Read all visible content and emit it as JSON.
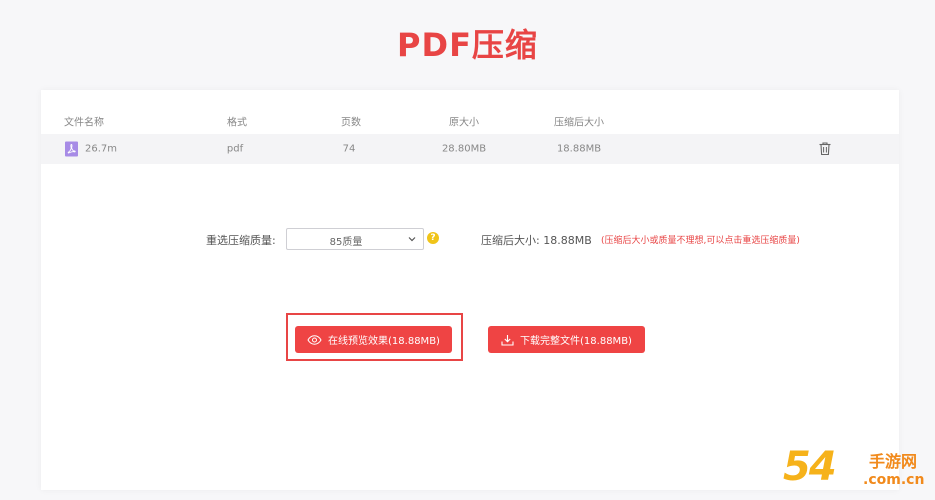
{
  "page": {
    "title": "PDF压缩"
  },
  "table": {
    "headers": [
      "文件名称",
      "格式",
      "页数",
      "原大小",
      "压缩后大小"
    ],
    "rows": [
      {
        "name": "26.7m",
        "format": "pdf",
        "pages": "74",
        "original_size": "28.80MB",
        "compressed_size": "18.88MB"
      }
    ]
  },
  "quality": {
    "label": "重选压缩质量:",
    "selected": "85质量",
    "help_glyph": "?",
    "after_label": "压缩后大小:",
    "after_value": "18.88MB",
    "note": "(压缩后大小或质量不理想,可以点击重选压缩质量)"
  },
  "actions": {
    "preview_label": "在线预览效果(18.88MB)",
    "download_label": "下载完整文件(18.88MB)"
  },
  "watermark": {
    "number": "54",
    "brand": "手游网",
    "domain": ".com.cn"
  },
  "colors": {
    "accent": "#ef4444",
    "title": "#e84545",
    "pdf_icon": "#a78be6",
    "help": "#f0c419",
    "watermark": "#f6b21a"
  },
  "icons": {
    "file": "pdf-file-icon",
    "delete": "trash-icon",
    "dropdown": "chevron-down-icon",
    "help": "help-icon",
    "preview": "eye-icon",
    "download": "download-icon"
  }
}
